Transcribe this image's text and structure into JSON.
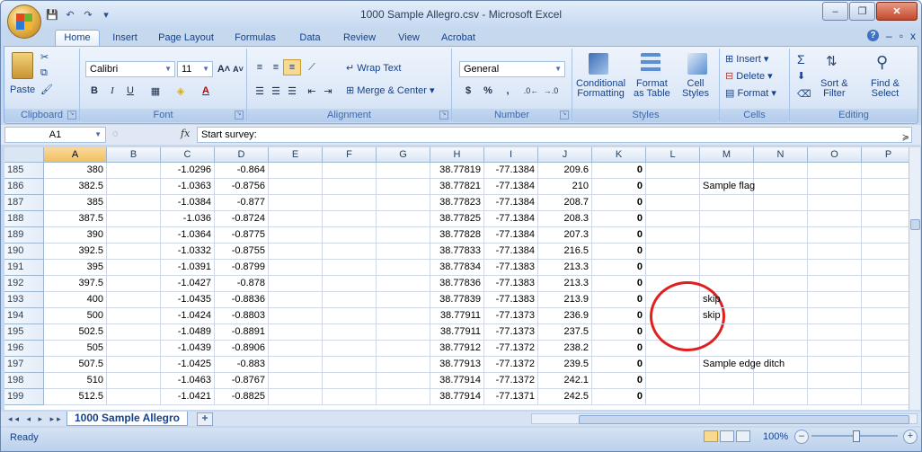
{
  "window": {
    "title": "1000 Sample Allegro.csv - Microsoft Excel",
    "controls": [
      "–",
      "❐",
      "✕"
    ]
  },
  "tabs": [
    "Home",
    "Insert",
    "Page Layout",
    "Formulas",
    "Data",
    "Review",
    "View",
    "Acrobat"
  ],
  "ribbon": {
    "clipboard": {
      "label": "Clipboard",
      "paste": "Paste"
    },
    "font": {
      "label": "Font",
      "name": "Calibri",
      "size": "11",
      "grow": "A˄",
      "shrink": "A˅",
      "bold": "B",
      "italic": "I",
      "underline": "U"
    },
    "alignment": {
      "label": "Alignment",
      "wrap": "Wrap Text",
      "merge": "Merge & Center"
    },
    "number": {
      "label": "Number",
      "format": "General",
      "currency": "$",
      "percent": "%",
      "comma": ","
    },
    "styles": {
      "label": "Styles",
      "conditional": "Conditional\nFormatting",
      "format_table": "Format\nas Table",
      "cell_styles": "Cell\nStyles"
    },
    "cells": {
      "label": "Cells",
      "insert": "Insert",
      "delete": "Delete",
      "format": "Format"
    },
    "editing": {
      "label": "Editing",
      "sigma": "Σ",
      "sort": "Sort &\nFilter",
      "find": "Find &\nSelect"
    }
  },
  "formula_bar": {
    "name_box": "A1",
    "fx": "fx",
    "content": "Start survey:"
  },
  "columns": [
    "A",
    "B",
    "C",
    "D",
    "E",
    "F",
    "G",
    "H",
    "I",
    "J",
    "K",
    "L",
    "M",
    "N",
    "O",
    "P"
  ],
  "selected_column": "A",
  "rows": [
    {
      "n": "185",
      "A": "380",
      "C": "-1.0296",
      "D": "-0.864",
      "H": "38.77819",
      "I": "-77.1384",
      "J": "209.6",
      "K": "0",
      "M": ""
    },
    {
      "n": "186",
      "A": "382.5",
      "C": "-1.0363",
      "D": "-0.8756",
      "H": "38.77821",
      "I": "-77.1384",
      "J": "210",
      "K": "0",
      "M": "Sample flag"
    },
    {
      "n": "187",
      "A": "385",
      "C": "-1.0384",
      "D": "-0.877",
      "H": "38.77823",
      "I": "-77.1384",
      "J": "208.7",
      "K": "0",
      "M": ""
    },
    {
      "n": "188",
      "A": "387.5",
      "C": "-1.036",
      "D": "-0.8724",
      "H": "38.77825",
      "I": "-77.1384",
      "J": "208.3",
      "K": "0",
      "M": ""
    },
    {
      "n": "189",
      "A": "390",
      "C": "-1.0364",
      "D": "-0.8775",
      "H": "38.77828",
      "I": "-77.1384",
      "J": "207.3",
      "K": "0",
      "M": ""
    },
    {
      "n": "190",
      "A": "392.5",
      "C": "-1.0332",
      "D": "-0.8755",
      "H": "38.77833",
      "I": "-77.1384",
      "J": "216.5",
      "K": "0",
      "M": ""
    },
    {
      "n": "191",
      "A": "395",
      "C": "-1.0391",
      "D": "-0.8799",
      "H": "38.77834",
      "I": "-77.1383",
      "J": "213.3",
      "K": "0",
      "M": ""
    },
    {
      "n": "192",
      "A": "397.5",
      "C": "-1.0427",
      "D": "-0.878",
      "H": "38.77836",
      "I": "-77.1383",
      "J": "213.3",
      "K": "0",
      "M": ""
    },
    {
      "n": "193",
      "A": "400",
      "C": "-1.0435",
      "D": "-0.8836",
      "H": "38.77839",
      "I": "-77.1383",
      "J": "213.9",
      "K": "0",
      "M": "skip"
    },
    {
      "n": "194",
      "A": "500",
      "C": "-1.0424",
      "D": "-0.8803",
      "H": "38.77911",
      "I": "-77.1373",
      "J": "236.9",
      "K": "0",
      "M": "skip"
    },
    {
      "n": "195",
      "A": "502.5",
      "C": "-1.0489",
      "D": "-0.8891",
      "H": "38.77911",
      "I": "-77.1373",
      "J": "237.5",
      "K": "0",
      "M": ""
    },
    {
      "n": "196",
      "A": "505",
      "C": "-1.0439",
      "D": "-0.8906",
      "H": "38.77912",
      "I": "-77.1372",
      "J": "238.2",
      "K": "0",
      "M": ""
    },
    {
      "n": "197",
      "A": "507.5",
      "C": "-1.0425",
      "D": "-0.883",
      "H": "38.77913",
      "I": "-77.1372",
      "J": "239.5",
      "K": "0",
      "M": "Sample edge ditch"
    },
    {
      "n": "198",
      "A": "510",
      "C": "-1.0463",
      "D": "-0.8767",
      "H": "38.77914",
      "I": "-77.1372",
      "J": "242.1",
      "K": "0",
      "M": ""
    },
    {
      "n": "199",
      "A": "512.5",
      "C": "-1.0421",
      "D": "-0.8825",
      "H": "38.77914",
      "I": "-77.1371",
      "J": "242.5",
      "K": "0",
      "M": ""
    }
  ],
  "sheet_tab": "1000 Sample Allegro",
  "status": {
    "text": "Ready",
    "zoom": "100%"
  },
  "annotation_color": "#e02020"
}
